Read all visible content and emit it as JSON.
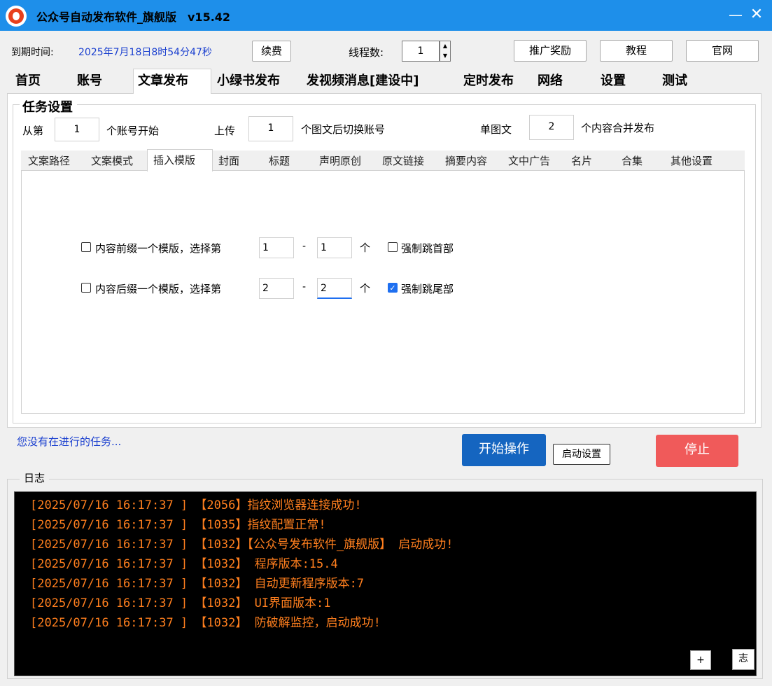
{
  "window": {
    "title": "公众号自动发布软件_旗舰版　v15.42",
    "minimize": "—",
    "close": "✕"
  },
  "toolbar": {
    "expiry_label": "到期时间:",
    "expiry_value": "2025年7月18日8时54分47秒",
    "renew": "续费",
    "threads_label": "线程数:",
    "threads_value": "1",
    "promo": "推广奖励",
    "tutorial": "教程",
    "website": "官网"
  },
  "tabs": [
    "首页",
    "账号",
    "文章发布",
    "小绿书发布",
    "发视频消息[建设中]",
    "定时发布",
    "网络",
    "设置",
    "测试"
  ],
  "task": {
    "group_title": "任务设置",
    "from_label": "从第",
    "from_value": "1",
    "from_suffix": "个账号开始",
    "upload_label": "上传",
    "upload_value": "1",
    "upload_suffix": "个图文后切换账号",
    "single_label": "单图文",
    "single_value": "2",
    "single_suffix": "个内容合并发布"
  },
  "subtabs": [
    "文案路径",
    "文案模式",
    "插入模版",
    "封面",
    "标题",
    "声明原创",
    "原文链接",
    "摘要内容",
    "文中广告",
    "名片",
    "合集",
    "其他设置"
  ],
  "template": {
    "prefix_label": "内容前缀一个模版，选择第",
    "prefix_from": "1",
    "prefix_dash": "-",
    "prefix_to": "1",
    "prefix_unit": "个",
    "force_head": "强制跳首部",
    "suffix_label": "内容后缀一个模版，选择第",
    "suffix_from": "2",
    "suffix_dash": "-",
    "suffix_to": "2",
    "suffix_unit": "个",
    "force_tail": "强制跳尾部"
  },
  "status": {
    "no_task": "您没有在进行的任务...",
    "start": "开始操作",
    "startup_settings": "启动设置",
    "stop": "停止"
  },
  "log": {
    "title": "日志",
    "lines": [
      "[2025/07/16 16:17:37 ] 【2056】指纹浏览器连接成功!",
      "[2025/07/16 16:17:37 ] 【1035】指纹配置正常!",
      "[2025/07/16 16:17:37 ] 【1032】【公众号发布软件_旗舰版】 启动成功!",
      "[2025/07/16 16:17:37 ] 【1032】 程序版本:15.4",
      "[2025/07/16 16:17:37 ] 【1032】 自动更新程序版本:7",
      "[2025/07/16 16:17:37 ] 【1032】 UI界面版本:1",
      "[2025/07/16 16:17:37 ] 【1032】 防破解监控，启动成功!"
    ],
    "plus": "+",
    "zhi": "志"
  },
  "colors": {
    "titlebar": "#1e8fea",
    "start_button": "#1565c0",
    "stop_button": "#f05a5a",
    "log_text": "#ff7f1e",
    "expiry_text": "#1a3fcf"
  }
}
